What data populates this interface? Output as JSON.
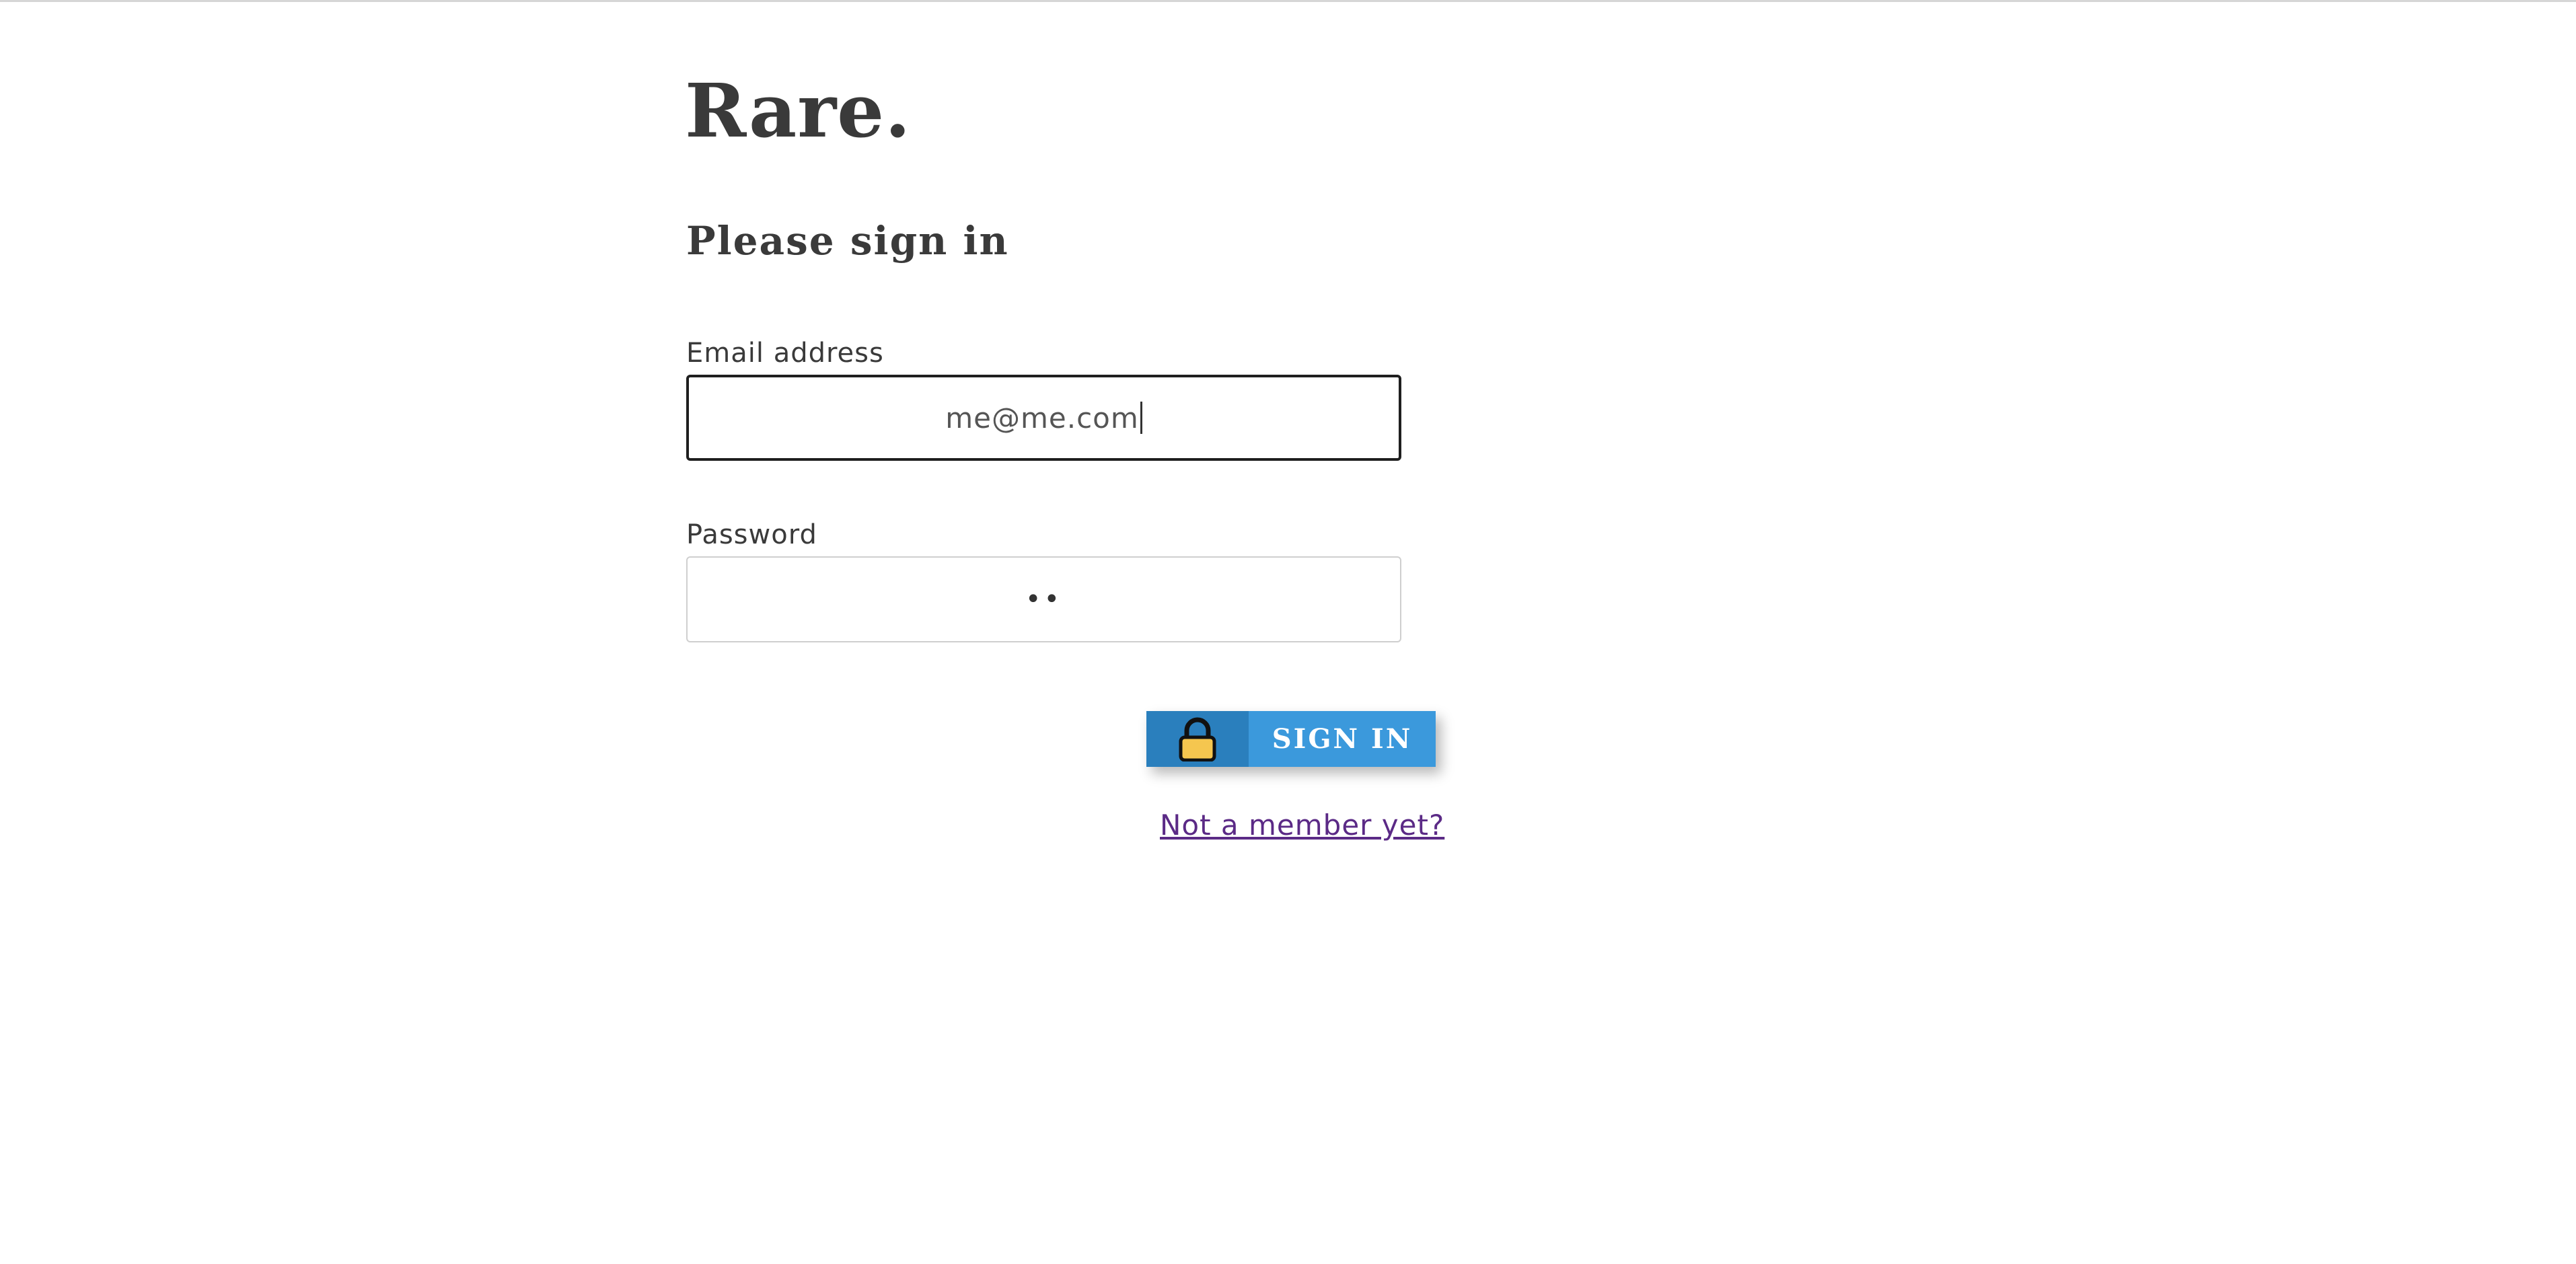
{
  "brand": {
    "logo": "Rare."
  },
  "form": {
    "heading": "Please sign in",
    "email": {
      "label": "Email address",
      "value": "me@me.com"
    },
    "password": {
      "label": "Password",
      "masked_value": "••"
    },
    "submit": {
      "label": "SIGN IN",
      "icon": "lock-icon"
    },
    "register_link": "Not a member yet?"
  },
  "colors": {
    "button_icon_bg": "#2a7fbd",
    "button_bg": "#3b99dc",
    "link": "#5b2a86",
    "lock_body": "#f5c64f"
  }
}
